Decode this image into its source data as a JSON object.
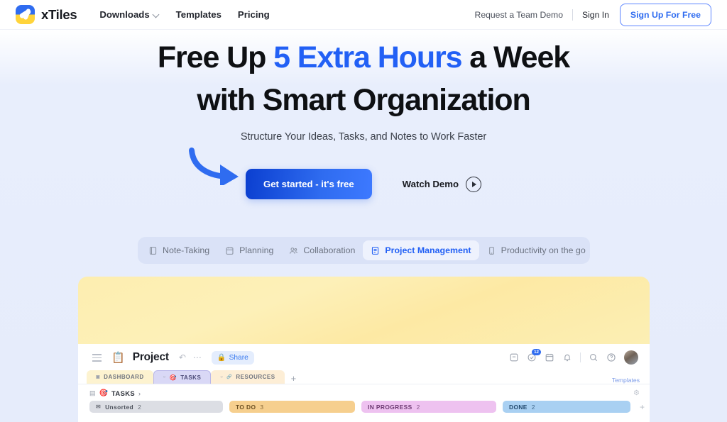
{
  "header": {
    "logo_text": "xTiles",
    "nav": [
      {
        "label": "Downloads",
        "has_chevron": true
      },
      {
        "label": "Templates",
        "has_chevron": false
      },
      {
        "label": "Pricing",
        "has_chevron": false
      }
    ],
    "request_demo": "Request a Team Demo",
    "sign_in": "Sign In",
    "sign_up": "Sign Up For Free"
  },
  "hero": {
    "headline_part1": "Free Up ",
    "headline_accent": "5 Extra Hours",
    "headline_part2": " a Week",
    "headline_line2": "with Smart Organization",
    "subhead": "Structure Your Ideas, Tasks, and Notes to Work Faster",
    "cta_label": "Get started - it's free",
    "watch_demo_label": "Watch Demo",
    "accent_color": "#2260f5"
  },
  "feature_tabs": [
    {
      "label": "Note-Taking",
      "icon": "notebook-icon",
      "active": false
    },
    {
      "label": "Planning",
      "icon": "calendar-icon",
      "active": false
    },
    {
      "label": "Collaboration",
      "icon": "people-icon",
      "active": false
    },
    {
      "label": "Project Management",
      "icon": "document-icon",
      "active": true
    },
    {
      "label": "Productivity on the go",
      "icon": "mobile-icon",
      "active": false
    }
  ],
  "app": {
    "doc_emoji": "📋",
    "doc_title": "Project",
    "share_label": "Share",
    "notification_badge": "12",
    "tabs": [
      {
        "label": "DASHBOARD",
        "active": false
      },
      {
        "label": "TASKS",
        "active": true
      },
      {
        "label": "RESOURCES",
        "active": false
      }
    ],
    "templates_link": "Templates",
    "section": {
      "emoji": "🎯",
      "title": "TASKS",
      "chevron": "›"
    },
    "columns": [
      {
        "label": "Unsorted",
        "count": "2",
        "color": "#dcdee4"
      },
      {
        "label": "TO DO",
        "count": "3",
        "color": "#f6cf8e"
      },
      {
        "label": "IN PROGRESS",
        "count": "2",
        "color": "#eec2f0"
      },
      {
        "label": "DONE",
        "count": "2",
        "color": "#a9d0f2"
      }
    ]
  }
}
